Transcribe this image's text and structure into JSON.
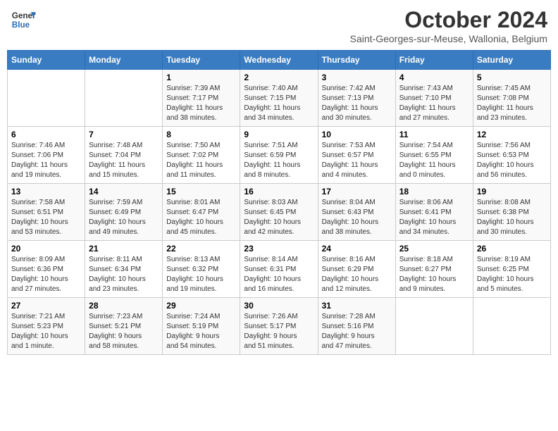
{
  "header": {
    "logo_line1": "General",
    "logo_line2": "Blue",
    "title": "October 2024",
    "subtitle": "Saint-Georges-sur-Meuse, Wallonia, Belgium"
  },
  "calendar": {
    "days_of_week": [
      "Sunday",
      "Monday",
      "Tuesday",
      "Wednesday",
      "Thursday",
      "Friday",
      "Saturday"
    ],
    "weeks": [
      [
        {
          "day": "",
          "info": ""
        },
        {
          "day": "",
          "info": ""
        },
        {
          "day": "1",
          "info": "Sunrise: 7:39 AM\nSunset: 7:17 PM\nDaylight: 11 hours\nand 38 minutes."
        },
        {
          "day": "2",
          "info": "Sunrise: 7:40 AM\nSunset: 7:15 PM\nDaylight: 11 hours\nand 34 minutes."
        },
        {
          "day": "3",
          "info": "Sunrise: 7:42 AM\nSunset: 7:13 PM\nDaylight: 11 hours\nand 30 minutes."
        },
        {
          "day": "4",
          "info": "Sunrise: 7:43 AM\nSunset: 7:10 PM\nDaylight: 11 hours\nand 27 minutes."
        },
        {
          "day": "5",
          "info": "Sunrise: 7:45 AM\nSunset: 7:08 PM\nDaylight: 11 hours\nand 23 minutes."
        }
      ],
      [
        {
          "day": "6",
          "info": "Sunrise: 7:46 AM\nSunset: 7:06 PM\nDaylight: 11 hours\nand 19 minutes."
        },
        {
          "day": "7",
          "info": "Sunrise: 7:48 AM\nSunset: 7:04 PM\nDaylight: 11 hours\nand 15 minutes."
        },
        {
          "day": "8",
          "info": "Sunrise: 7:50 AM\nSunset: 7:02 PM\nDaylight: 11 hours\nand 11 minutes."
        },
        {
          "day": "9",
          "info": "Sunrise: 7:51 AM\nSunset: 6:59 PM\nDaylight: 11 hours\nand 8 minutes."
        },
        {
          "day": "10",
          "info": "Sunrise: 7:53 AM\nSunset: 6:57 PM\nDaylight: 11 hours\nand 4 minutes."
        },
        {
          "day": "11",
          "info": "Sunrise: 7:54 AM\nSunset: 6:55 PM\nDaylight: 11 hours\nand 0 minutes."
        },
        {
          "day": "12",
          "info": "Sunrise: 7:56 AM\nSunset: 6:53 PM\nDaylight: 10 hours\nand 56 minutes."
        }
      ],
      [
        {
          "day": "13",
          "info": "Sunrise: 7:58 AM\nSunset: 6:51 PM\nDaylight: 10 hours\nand 53 minutes."
        },
        {
          "day": "14",
          "info": "Sunrise: 7:59 AM\nSunset: 6:49 PM\nDaylight: 10 hours\nand 49 minutes."
        },
        {
          "day": "15",
          "info": "Sunrise: 8:01 AM\nSunset: 6:47 PM\nDaylight: 10 hours\nand 45 minutes."
        },
        {
          "day": "16",
          "info": "Sunrise: 8:03 AM\nSunset: 6:45 PM\nDaylight: 10 hours\nand 42 minutes."
        },
        {
          "day": "17",
          "info": "Sunrise: 8:04 AM\nSunset: 6:43 PM\nDaylight: 10 hours\nand 38 minutes."
        },
        {
          "day": "18",
          "info": "Sunrise: 8:06 AM\nSunset: 6:41 PM\nDaylight: 10 hours\nand 34 minutes."
        },
        {
          "day": "19",
          "info": "Sunrise: 8:08 AM\nSunset: 6:38 PM\nDaylight: 10 hours\nand 30 minutes."
        }
      ],
      [
        {
          "day": "20",
          "info": "Sunrise: 8:09 AM\nSunset: 6:36 PM\nDaylight: 10 hours\nand 27 minutes."
        },
        {
          "day": "21",
          "info": "Sunrise: 8:11 AM\nSunset: 6:34 PM\nDaylight: 10 hours\nand 23 minutes."
        },
        {
          "day": "22",
          "info": "Sunrise: 8:13 AM\nSunset: 6:32 PM\nDaylight: 10 hours\nand 19 minutes."
        },
        {
          "day": "23",
          "info": "Sunrise: 8:14 AM\nSunset: 6:31 PM\nDaylight: 10 hours\nand 16 minutes."
        },
        {
          "day": "24",
          "info": "Sunrise: 8:16 AM\nSunset: 6:29 PM\nDaylight: 10 hours\nand 12 minutes."
        },
        {
          "day": "25",
          "info": "Sunrise: 8:18 AM\nSunset: 6:27 PM\nDaylight: 10 hours\nand 9 minutes."
        },
        {
          "day": "26",
          "info": "Sunrise: 8:19 AM\nSunset: 6:25 PM\nDaylight: 10 hours\nand 5 minutes."
        }
      ],
      [
        {
          "day": "27",
          "info": "Sunrise: 7:21 AM\nSunset: 5:23 PM\nDaylight: 10 hours\nand 1 minute."
        },
        {
          "day": "28",
          "info": "Sunrise: 7:23 AM\nSunset: 5:21 PM\nDaylight: 9 hours\nand 58 minutes."
        },
        {
          "day": "29",
          "info": "Sunrise: 7:24 AM\nSunset: 5:19 PM\nDaylight: 9 hours\nand 54 minutes."
        },
        {
          "day": "30",
          "info": "Sunrise: 7:26 AM\nSunset: 5:17 PM\nDaylight: 9 hours\nand 51 minutes."
        },
        {
          "day": "31",
          "info": "Sunrise: 7:28 AM\nSunset: 5:16 PM\nDaylight: 9 hours\nand 47 minutes."
        },
        {
          "day": "",
          "info": ""
        },
        {
          "day": "",
          "info": ""
        }
      ]
    ]
  }
}
